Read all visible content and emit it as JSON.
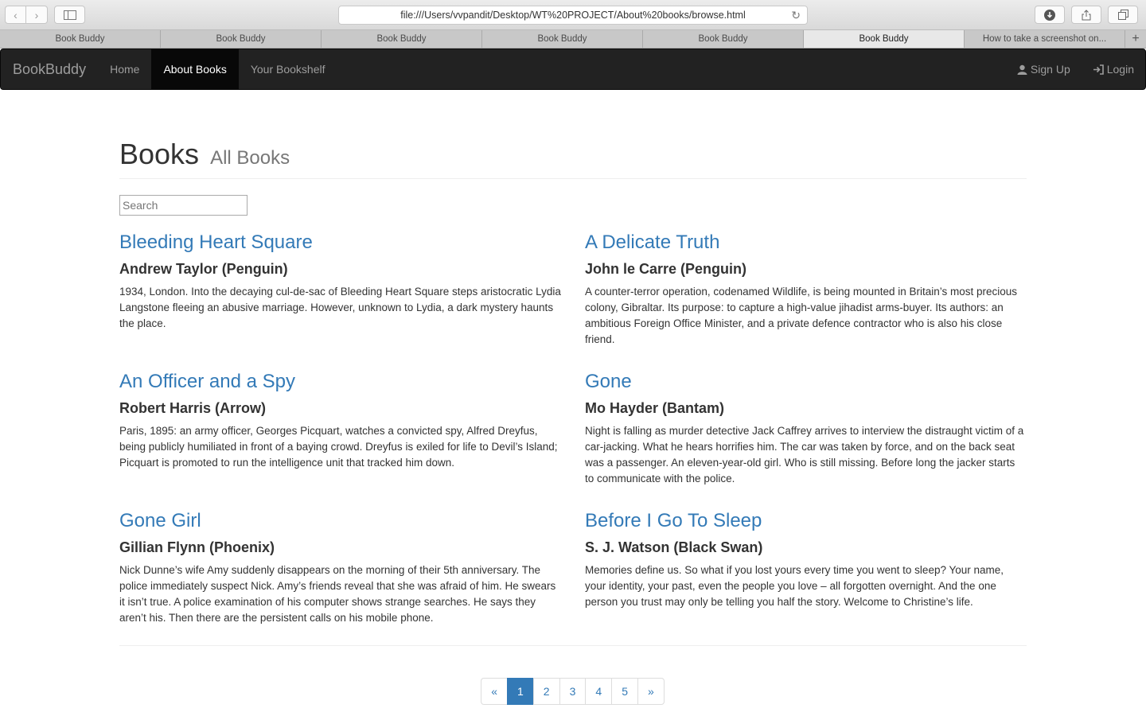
{
  "browser": {
    "url": "file:///Users/vvpandit/Desktop/WT%20PROJECT/About%20books/browse.html",
    "tabs": [
      {
        "label": "Book Buddy",
        "active": false
      },
      {
        "label": "Book Buddy",
        "active": false
      },
      {
        "label": "Book Buddy",
        "active": false
      },
      {
        "label": "Book Buddy",
        "active": false
      },
      {
        "label": "Book Buddy",
        "active": false
      },
      {
        "label": "Book Buddy",
        "active": true
      },
      {
        "label": "How to take a screenshot on...",
        "active": false
      }
    ]
  },
  "navbar": {
    "brand": "BookBuddy",
    "items": [
      "Home",
      "About Books",
      "Your Bookshelf"
    ],
    "active_index": 1,
    "signup": "Sign Up",
    "login": "Login"
  },
  "header": {
    "title": "Books",
    "subtitle": "All Books"
  },
  "search": {
    "placeholder": "Search"
  },
  "books": [
    {
      "title": "Bleeding Heart Square",
      "author": "Andrew Taylor (Penguin)",
      "description": "1934, London. Into the decaying cul-de-sac of Bleeding Heart Square steps aristocratic Lydia Langstone fleeing an abusive marriage. However, unknown to Lydia, a dark mystery haunts the place."
    },
    {
      "title": "A Delicate Truth",
      "author": "John le Carre (Penguin)",
      "description": "A counter-terror operation, codenamed Wildlife, is being mounted in Britain’s most precious colony, Gibraltar. Its purpose: to capture a high-value jihadist arms-buyer. Its authors: an ambitious Foreign Office Minister, and a private defence contractor who is also his close friend."
    },
    {
      "title": "An Officer and a Spy",
      "author": "Robert Harris (Arrow)",
      "description": "Paris, 1895: an army officer, Georges Picquart, watches a convicted spy, Alfred Dreyfus, being publicly humiliated in front of a baying crowd. Dreyfus is exiled for life to Devil’s Island; Picquart is promoted to run the intelligence unit that tracked him down."
    },
    {
      "title": "Gone",
      "author": "Mo Hayder (Bantam)",
      "description": "Night is falling as murder detective Jack Caffrey arrives to interview the distraught victim of a car-jacking. What he hears horrifies him. The car was taken by force, and on the back seat was a passenger. An eleven-year-old girl. Who is still missing. Before long the jacker starts to communicate with the police."
    },
    {
      "title": "Gone Girl",
      "author": "Gillian Flynn (Phoenix)",
      "description": "Nick Dunne’s wife Amy suddenly disappears on the morning of their 5th anniversary. The police immediately suspect Nick. Amy’s friends reveal that she was afraid of him. He swears it isn’t true. A police examination of his computer shows strange searches. He says they aren’t his. Then there are the persistent calls on his mobile phone."
    },
    {
      "title": "Before I Go To Sleep",
      "author": "S. J. Watson (Black Swan)",
      "description": "Memories define us. So what if you lost yours every time you went to sleep? Your name, your identity, your past, even the people you love – all forgotten overnight. And the one person you trust may only be telling you half the story. Welcome to Christine’s life."
    }
  ],
  "pagination": {
    "prev": "«",
    "next": "»",
    "pages": [
      "1",
      "2",
      "3",
      "4",
      "5"
    ],
    "current": "1"
  }
}
